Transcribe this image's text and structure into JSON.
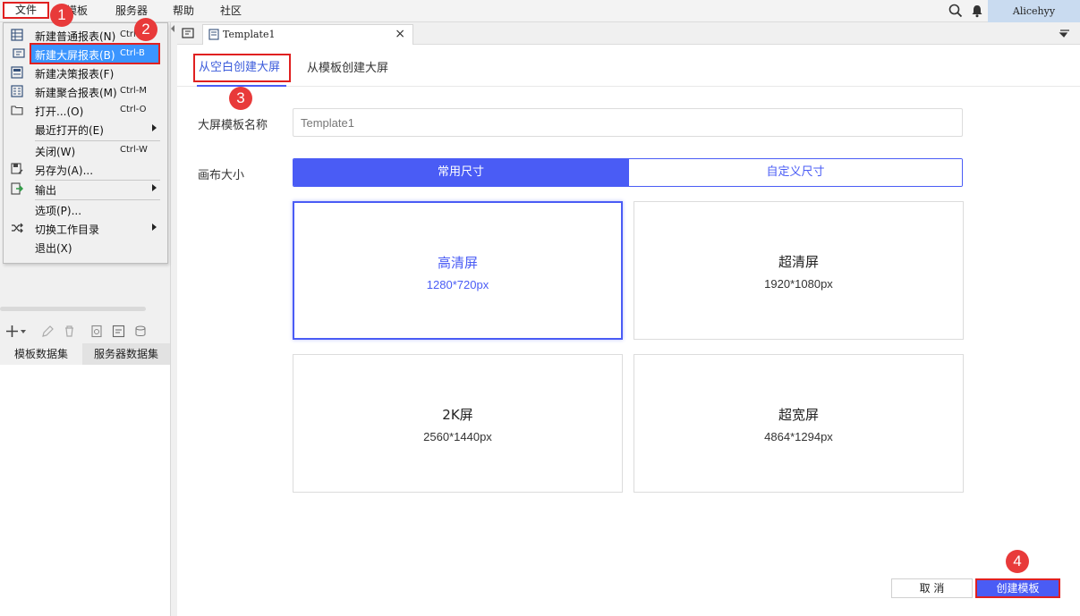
{
  "menubar": {
    "items": [
      "文件",
      "模板",
      "服务器",
      "帮助",
      "社区"
    ],
    "user": "Alicehyy"
  },
  "file_menu": {
    "items": [
      {
        "label": "新建普通报表(N)",
        "shortcut": "Ctrl-",
        "icon": "grid-report-icon"
      },
      {
        "label": "新建大屏报表(B)",
        "shortcut": "Ctrl-B",
        "icon": "screen-report-icon",
        "highlighted": true
      },
      {
        "label": "新建决策报表(F)",
        "shortcut": "",
        "icon": "decision-report-icon"
      },
      {
        "label": "新建聚合报表(M)",
        "shortcut": "Ctrl-M",
        "icon": "aggregate-report-icon"
      },
      {
        "label": "打开...(O)",
        "shortcut": "Ctrl-O",
        "icon": "folder-open-icon"
      },
      {
        "label": "最近打开的(E)",
        "shortcut": "",
        "icon": "",
        "submenu": true
      },
      {
        "label": "关闭(W)",
        "shortcut": "Ctrl-W",
        "icon": ""
      },
      {
        "label": "另存为(A)...",
        "shortcut": "",
        "icon": "save-as-icon"
      },
      {
        "label": "输出",
        "shortcut": "",
        "icon": "export-icon",
        "submenu": true
      },
      {
        "label": "选项(P)...",
        "shortcut": "",
        "icon": ""
      },
      {
        "label": "切换工作目录",
        "shortcut": "",
        "icon": "shuffle-icon",
        "submenu": true
      },
      {
        "label": "退出(X)",
        "shortcut": "",
        "icon": ""
      }
    ]
  },
  "left_panel": {
    "tabs": [
      "模板数据集",
      "服务器数据集"
    ]
  },
  "doc_tab": {
    "title": "Template1",
    "close": "×"
  },
  "dialog": {
    "mode_tabs": [
      "从空白创建大屏",
      "从模板创建大屏"
    ],
    "name_label": "大屏模板名称",
    "name_value": "Template1",
    "size_label": "画布大小",
    "size_modes": [
      "常用尺寸",
      "自定义尺寸"
    ],
    "presets": [
      {
        "name": "高清屏",
        "size": "1280*720px",
        "selected": true
      },
      {
        "name": "超清屏",
        "size": "1920*1080px"
      },
      {
        "name": "2K屏",
        "size": "2560*1440px"
      },
      {
        "name": "超宽屏",
        "size": "4864*1294px"
      }
    ],
    "cancel": "取 消",
    "create": "创建模板"
  },
  "steps": [
    "1",
    "2",
    "3",
    "4"
  ],
  "colors": {
    "accent": "#4a5cf5",
    "highlight_menu": "#3b95ff",
    "annotation_red": "#e02020",
    "step_badge": "#e83a3a"
  }
}
